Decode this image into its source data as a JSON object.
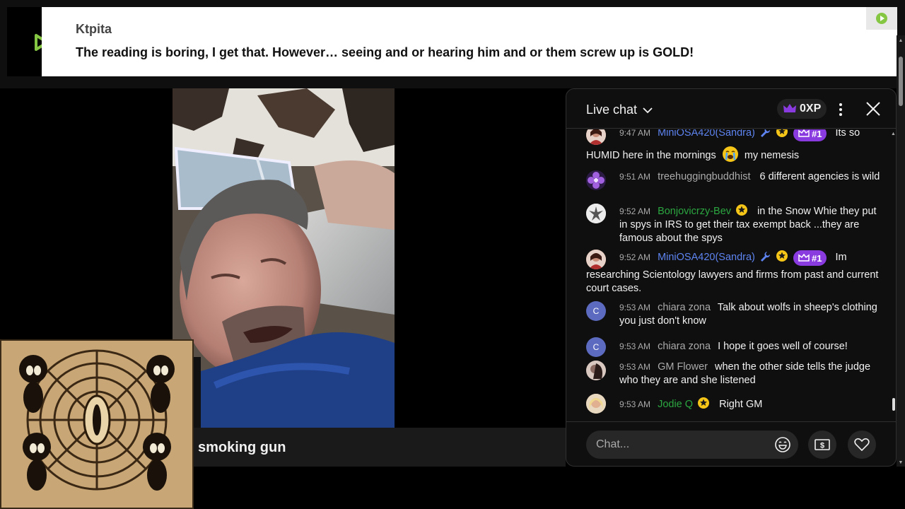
{
  "banner": {
    "username": "Ktpita",
    "message": "The reading is boring, I get that. However… seeing and or hearing him and or them screw up is GOLD!"
  },
  "video": {
    "title": "smoking gun"
  },
  "chat": {
    "title": "Live chat",
    "xp": "0XP",
    "input_placeholder": "Chat...",
    "messages": [
      {
        "time": "9:47 AM",
        "author": "MiniOSA420(Sandra)",
        "rank": "#1",
        "text_a": "Its so",
        "text_b": "HUMID here in the mornings",
        "text_c": "my nemesis",
        "avatar": "sandra-avatar"
      },
      {
        "time": "9:51 AM",
        "author": "treehuggingbuddhist",
        "text": "6 different agencies is wild",
        "avatar": "purple-flower-avatar"
      },
      {
        "time": "9:52 AM",
        "author": "Bonjovicrzy-Bev",
        "text": "in the Snow Whie they put in spys in IRS to get their tax exempt back ...they are famous about the spys",
        "avatar": "eagle-avatar"
      },
      {
        "time": "9:52 AM",
        "author": "MiniOSA420(Sandra)",
        "rank": "#1",
        "text_a": "Im",
        "text_b": "researching Scientology lawyers and firms from past and current court cases.",
        "avatar": "sandra-avatar"
      },
      {
        "time": "9:53 AM",
        "author": "chiara zona",
        "text": "Talk about wolfs in sheep's clothing you just don't know",
        "avatar_letter": "C"
      },
      {
        "time": "9:53 AM",
        "author": "chiara zona",
        "text": "I hope it goes well of course!",
        "avatar_letter": "C"
      },
      {
        "time": "9:53 AM",
        "author": "GM Flower",
        "text": "when the other side tells the judge who they are and she listened",
        "avatar": "gm-flower-avatar"
      },
      {
        "time": "9:53 AM",
        "author": "Jodie Q",
        "text": "Right GM",
        "avatar": "jodie-avatar"
      }
    ]
  },
  "colors": {
    "member_name": "#5e84f1",
    "verified_green": "#2ba640",
    "rank_purple": "#8a3be0",
    "rumble_green": "#85c742"
  }
}
